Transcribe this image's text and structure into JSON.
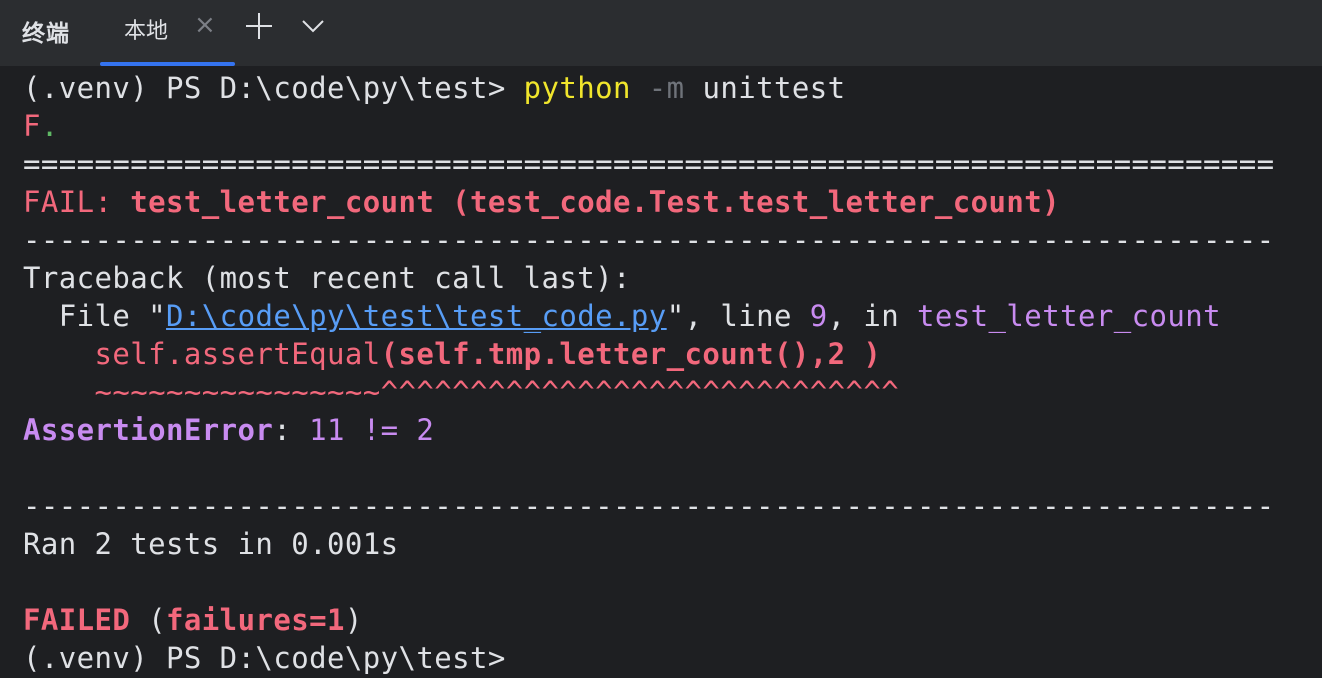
{
  "tabbar": {
    "title": "终端",
    "tab_label": "本地",
    "close_glyph": "×"
  },
  "colors": {
    "background": "#1e1f22",
    "tabbar": "#2b2d30",
    "accent": "#3574f0",
    "error_red": "#f2687c",
    "command_yellow": "#f0e52c",
    "success_green": "#5fb865",
    "purple": "#c88bf0",
    "link_blue": "#589df6"
  },
  "icons": [
    "close-icon",
    "plus-icon",
    "chevron-down-icon"
  ],
  "terminal": {
    "prompt": "(.venv) PS D:\\code\\py\\test> ",
    "cmd_name": "python",
    "cmd_flag": " -m",
    "cmd_arg": " unittest",
    "result_f": "F",
    "result_dot": ".",
    "sep_eq": "======================================================================",
    "fail_prefix": "FAIL: ",
    "fail_test": "test_letter_count (test_code.Test.test_letter_count)",
    "sep_dash": "----------------------------------------------------------------------",
    "traceback": "Traceback (most recent call last):",
    "file_pre": "  File \"",
    "file_path": "D:\\code\\py\\test\\test_code.py",
    "file_mid": "\", line ",
    "file_line": "9",
    "file_in": ", in ",
    "file_func": "test_letter_count",
    "code_pre": "    self.assertEqual",
    "code_args": "(self.tmp.letter_count(),2 )",
    "squiggle": "    ~~~~~~~~~~~~~~~~^^^^^^^^^^^^^^^^^^^^^^^^^^^^^",
    "err_name": "AssertionError",
    "err_colon": ": ",
    "err_msg": "11 != 2",
    "sep_dash2": "----------------------------------------------------------------------",
    "ran": "Ran 2 tests in 0.001s",
    "failed": "FAILED",
    "failed_open": " (",
    "failed_detail": "failures=1",
    "failed_close": ")",
    "final_prompt": "(.venv) PS D:\\code\\py\\test>"
  }
}
